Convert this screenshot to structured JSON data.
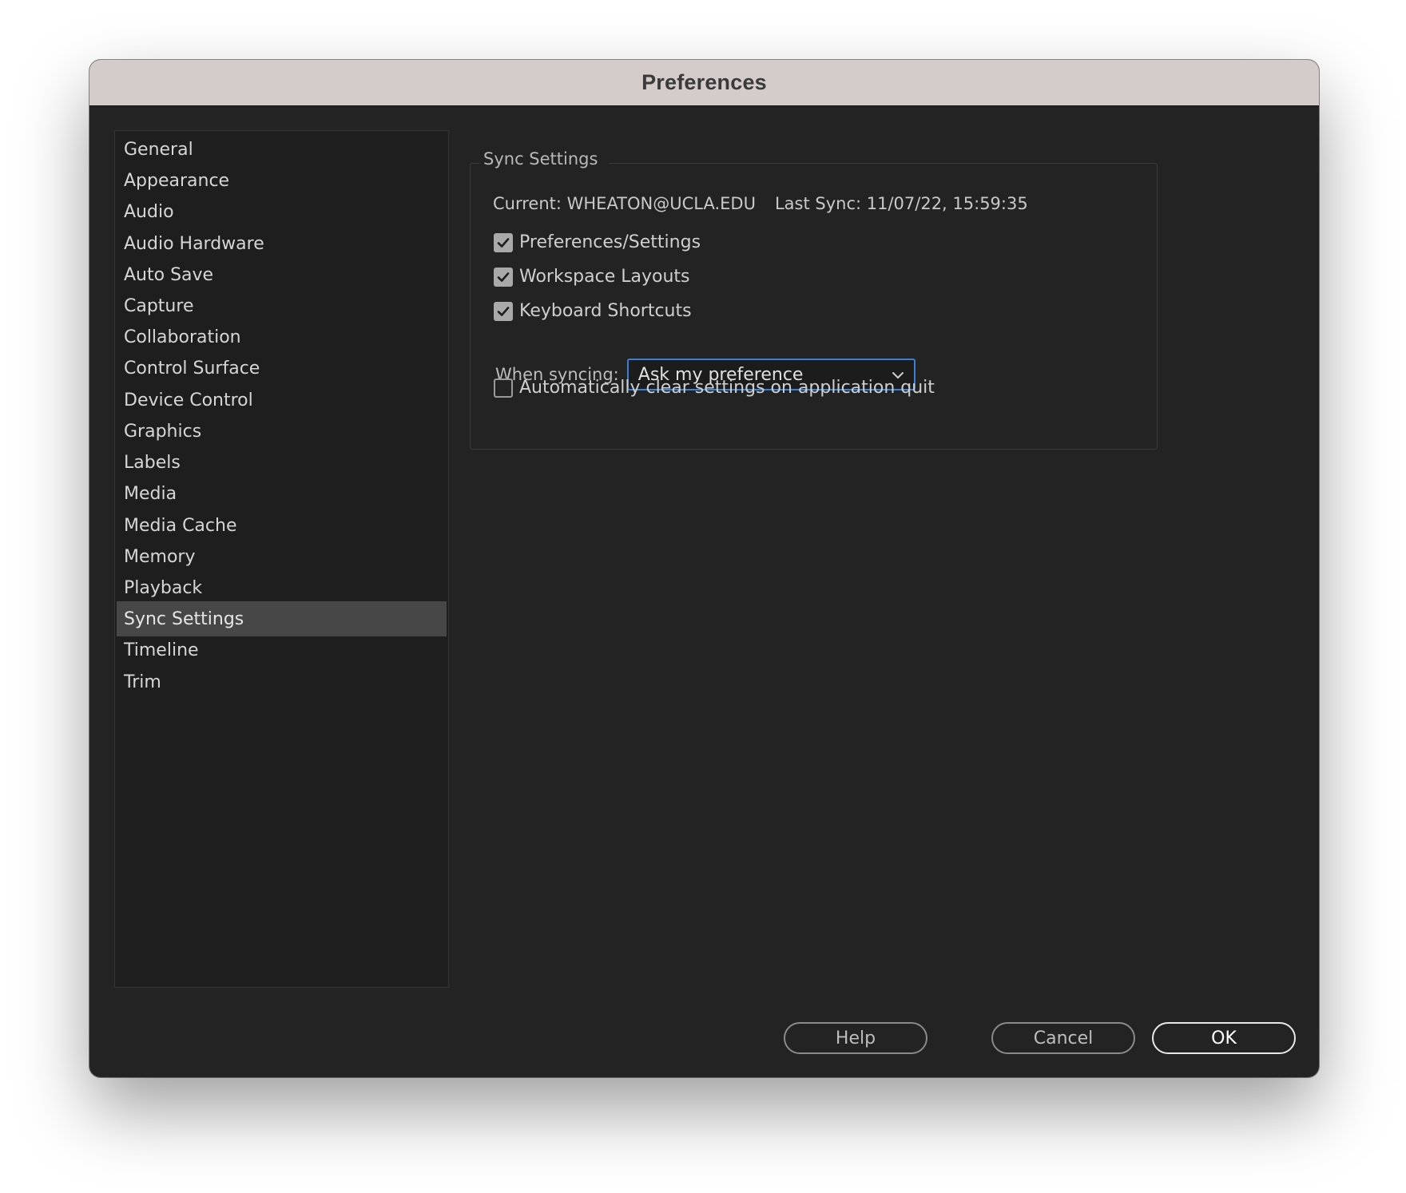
{
  "window": {
    "title": "Preferences"
  },
  "sidebar": {
    "items": [
      {
        "label": "General"
      },
      {
        "label": "Appearance"
      },
      {
        "label": "Audio"
      },
      {
        "label": "Audio Hardware"
      },
      {
        "label": "Auto Save"
      },
      {
        "label": "Capture"
      },
      {
        "label": "Collaboration"
      },
      {
        "label": "Control Surface"
      },
      {
        "label": "Device Control"
      },
      {
        "label": "Graphics"
      },
      {
        "label": "Labels"
      },
      {
        "label": "Media"
      },
      {
        "label": "Media Cache"
      },
      {
        "label": "Memory"
      },
      {
        "label": "Playback"
      },
      {
        "label": "Sync Settings",
        "selected": true
      },
      {
        "label": "Timeline"
      },
      {
        "label": "Trim"
      }
    ]
  },
  "sync": {
    "group_title": "Sync Settings",
    "current": "Current: WHEATON@UCLA.EDU",
    "last_sync": "Last Sync: 11/07/22, 15:59:35",
    "options": [
      {
        "label": "Preferences/Settings",
        "checked": true
      },
      {
        "label": "Workspace Layouts",
        "checked": true
      },
      {
        "label": "Keyboard Shortcuts",
        "checked": true
      }
    ],
    "when_syncing_label": "When syncing:",
    "when_syncing_value": "Ask my preference",
    "auto_clear": {
      "label": "Automatically clear settings on application quit",
      "checked": false
    }
  },
  "buttons": {
    "help": "Help",
    "cancel": "Cancel",
    "ok": "OK"
  },
  "colors": {
    "window_bg": "#232323",
    "titlebar_bg": "#d4cbcb",
    "sidebar_bg": "#1e1e1e",
    "selected_bg": "#474747",
    "focus_blue": "#3b7fd6"
  }
}
